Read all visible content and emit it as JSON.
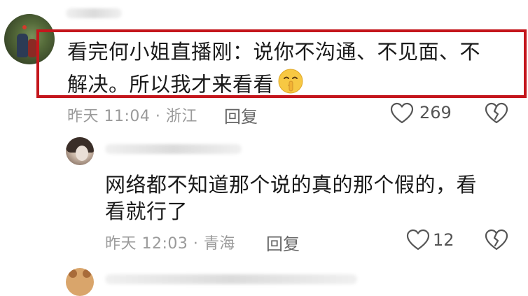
{
  "comments": [
    {
      "text_line1": "看完何小姐直播刚：说你不沟通、不见面、不",
      "text_line2": "解决。所以我才来看看",
      "emoji": "shushing-face-emoji",
      "time": "昨天 11:04",
      "location": "浙江",
      "reply_label": "回复",
      "likes": "269",
      "highlighted": true,
      "highlight_color": "#c4161c"
    },
    {
      "text_line1": "网络都不知道那个说的真的那个假的，看",
      "text_line2": "看就行了",
      "time": "昨天 12:03",
      "location": "青海",
      "reply_label": "回复",
      "likes": "12"
    }
  ],
  "meta_separator": "·",
  "icons": {
    "like": "heart-outline-icon",
    "dislike": "broken-heart-icon"
  }
}
